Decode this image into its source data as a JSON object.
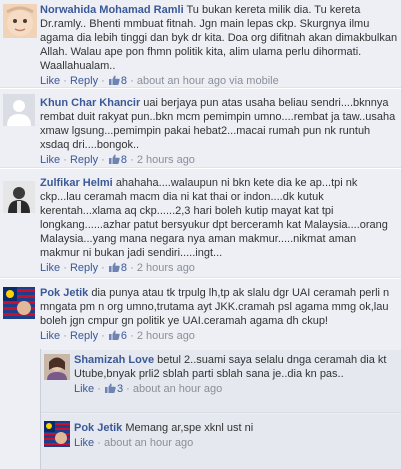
{
  "separator": "·",
  "comments": [
    {
      "author": "Norwahida Mohamad Ramli",
      "text": "Tu bukan kereta milik dia. Tu kereta Dr.ramly.. Bhenti mmbuat fitnah. Jgn main lepas ckp. Skurgnya ilmu agama dia lebih tinggi dan byk dr kita. Doa org difitnah akan dimakbulkan Allah. Walau ape pon fhmn politik kita, alim ulama perlu dihormati. Waallahualam..",
      "like_label": "Like",
      "reply_label": "Reply",
      "likes": "8",
      "time": "about an hour ago via mobile"
    },
    {
      "author": "Khun Char Khancir",
      "text": "uai berjaya pun atas usaha beliau sendri....bknnya rembat duit rakyat pun..bkn mcm pemimpin umno....rembat ja taw..usaha xmaw lgsung...pemimpin pakai hebat2...macai rumah pun nk runtuh xsdaq dri....bongok..",
      "like_label": "Like",
      "reply_label": "Reply",
      "likes": "8",
      "time": "2 hours ago"
    },
    {
      "author": "Zulfikar Helmi",
      "text": "ahahaha....walaupun ni bkn kete dia ke ap...tpi nk ckp...lau ceramah macm dia ni kat thai or indon....dk kutuk kerentah...xlama aq ckp......2,3 hari boleh kutip mayat kat tpi longkang......azhar patut bersyukur dpt berceramh kat Malaysia....orang Malaysia...yang mana negara nya aman makmur.....nikmat aman makmur ni bukan jadi sendiri.....ingt...",
      "like_label": "Like",
      "reply_label": "Reply",
      "likes": "8",
      "time": "2 hours ago"
    },
    {
      "author": "Pok Jetik",
      "text": "dia punya atau tk trpulg lh,tp ak slalu dgr UAI ceramah perli n mngata pm n org umno,trutama ayt JKK.cramah psl agama mmg ok,lau boleh jgn cmpur gn politik ye UAI.ceramah agama dh ckup!",
      "like_label": "Like",
      "reply_label": "Reply",
      "likes": "6",
      "time": "2 hours ago"
    }
  ],
  "replies": [
    {
      "author": "Shamizah Love",
      "text": "betul 2..suami saya selalu dnga ceramah dia kt Utube,bnyak prli2 sblah parti sblah sana je..dia kn pas..",
      "like_label": "Like",
      "likes": "3",
      "time": "about an hour ago"
    },
    {
      "author": "Pok Jetik",
      "text": "Memang ar,spe xknl ust ni",
      "like_label": "Like",
      "time": "about an hour ago"
    }
  ]
}
